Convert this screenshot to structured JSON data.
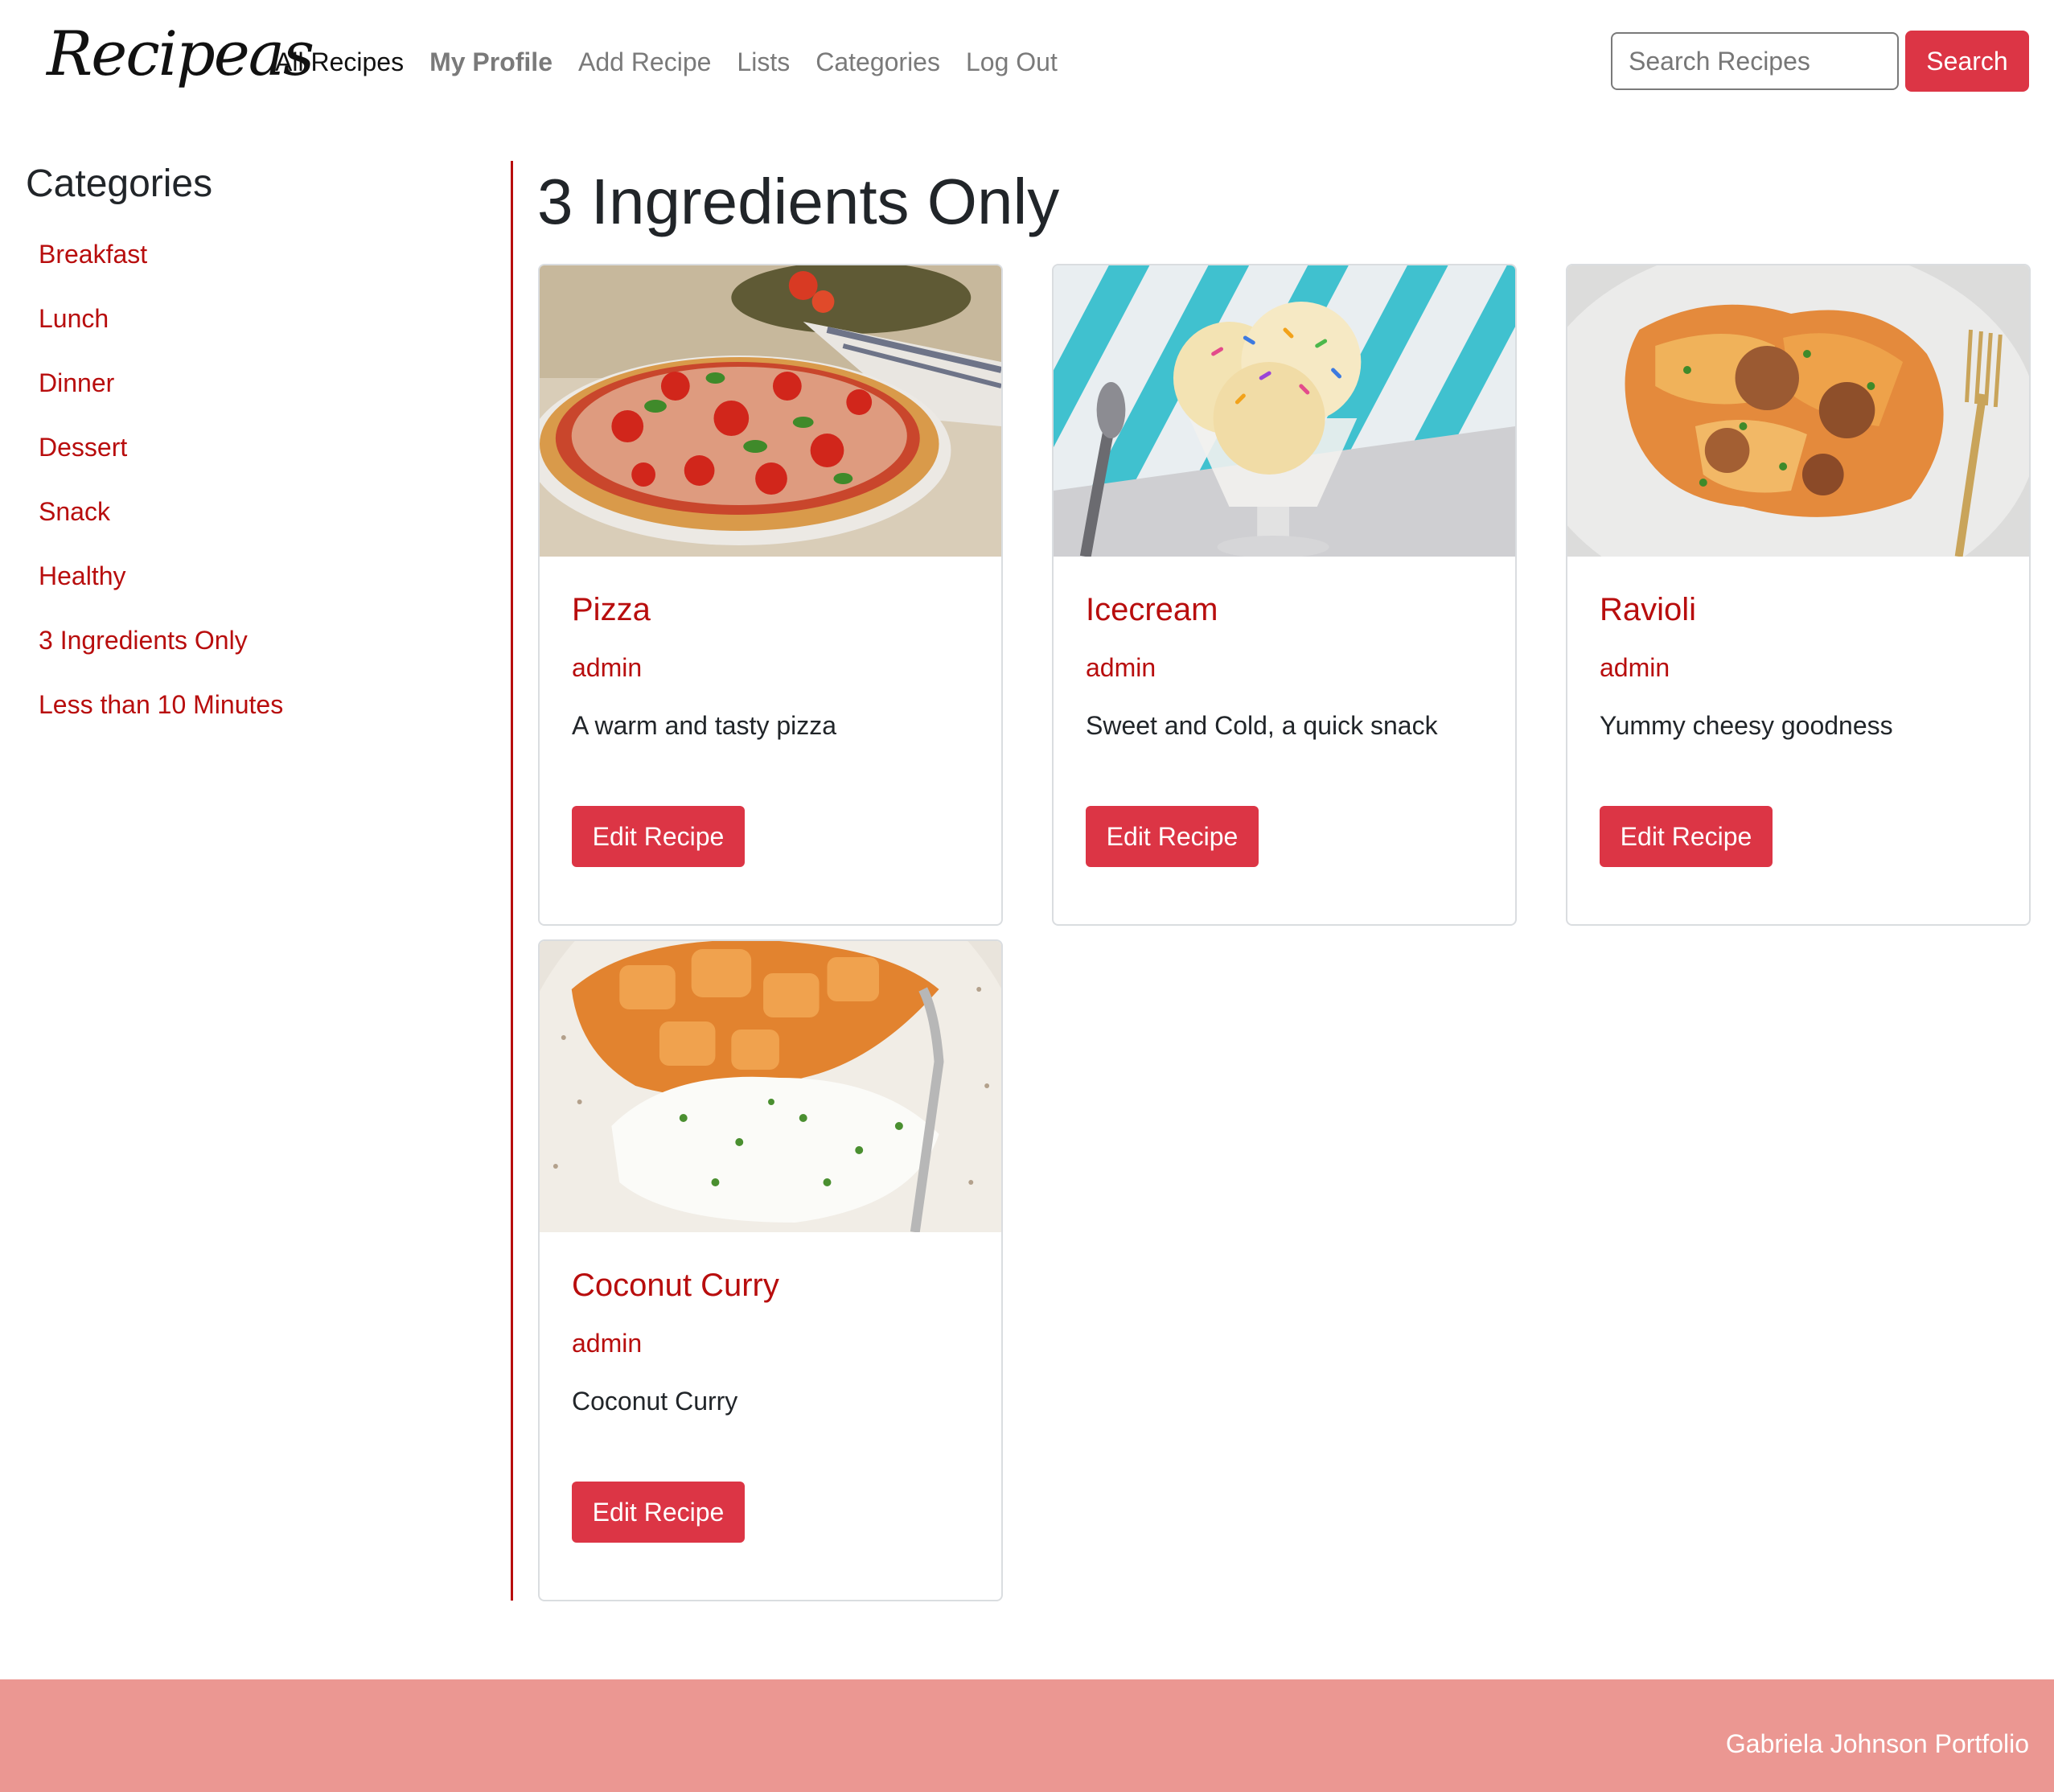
{
  "brand": "Recipeas",
  "nav": {
    "all_recipes": "All Recipes",
    "my_profile": "My Profile",
    "add_recipe": "Add Recipe",
    "lists": "Lists",
    "categories": "Categories",
    "log_out": "Log Out"
  },
  "search": {
    "placeholder": "Search Recipes",
    "button_label": "Search"
  },
  "sidebar": {
    "title": "Categories",
    "items": [
      "Breakfast",
      "Lunch",
      "Dinner",
      "Dessert",
      "Snack",
      "Healthy",
      "3 Ingredients Only",
      "Less than 10 Minutes"
    ]
  },
  "main": {
    "title": "3 Ingredients Only",
    "recipes": [
      {
        "title": "Pizza",
        "author": "admin",
        "description": "A warm and tasty pizza",
        "button": "Edit Recipe",
        "image": "pizza-photo"
      },
      {
        "title": "Icecream",
        "author": "admin",
        "description": "Sweet and Cold, a quick snack",
        "button": "Edit Recipe",
        "image": "icecream-photo"
      },
      {
        "title": "Ravioli",
        "author": "admin",
        "description": "Yummy cheesy goodness",
        "button": "Edit Recipe",
        "image": "ravioli-photo"
      },
      {
        "title": "Coconut Curry",
        "author": "admin",
        "description": "Coconut Curry",
        "button": "Edit Recipe",
        "image": "curry-photo"
      }
    ]
  },
  "footer": {
    "text": "Gabriela Johnson Portfolio"
  },
  "colors": {
    "accent": "#dc3545",
    "link": "#b80d0d",
    "footer_bg": "#eb9792"
  }
}
